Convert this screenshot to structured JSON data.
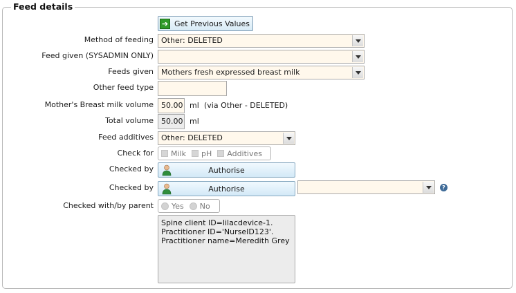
{
  "section": {
    "title": "Feed details"
  },
  "get_previous": {
    "label": "Get Previous Values"
  },
  "method_of_feeding": {
    "label": "Method of feeding",
    "value": "Other: DELETED"
  },
  "feed_given_sysadmin": {
    "label": "Feed given (SYSADMIN ONLY)",
    "value": ""
  },
  "feeds_given": {
    "label": "Feeds given",
    "value": "Mothers fresh expressed breast milk"
  },
  "other_feed_type": {
    "label": "Other feed type",
    "value": ""
  },
  "breast_milk_volume": {
    "label": "Mother's Breast milk volume",
    "value": "50.00",
    "unit": "ml",
    "note": "(via Other - DELETED)"
  },
  "total_volume": {
    "label": "Total volume",
    "value": "50.00",
    "unit": "ml"
  },
  "feed_additives": {
    "label": "Feed additives",
    "value": "Other: DELETED"
  },
  "check_for": {
    "label": "Check for",
    "options": [
      "Milk",
      "pH",
      "Additives"
    ]
  },
  "checked_by_1": {
    "label": "Checked by",
    "button": "Authorise"
  },
  "checked_by_2": {
    "label": "Checked by",
    "button": "Authorise",
    "select_value": ""
  },
  "checked_with_parent": {
    "label": "Checked with/by parent",
    "options": [
      "Yes",
      "No"
    ]
  },
  "info_box": {
    "text": "Spine client ID=lilacdevice-1.\nPractitioner ID='NurseID123'.\nPractitioner name=Meredith Grey"
  },
  "colors": {
    "field_bg": "#fff8ec",
    "button_bg": "#d8ebf6",
    "readonly_bg": "#ececec"
  }
}
